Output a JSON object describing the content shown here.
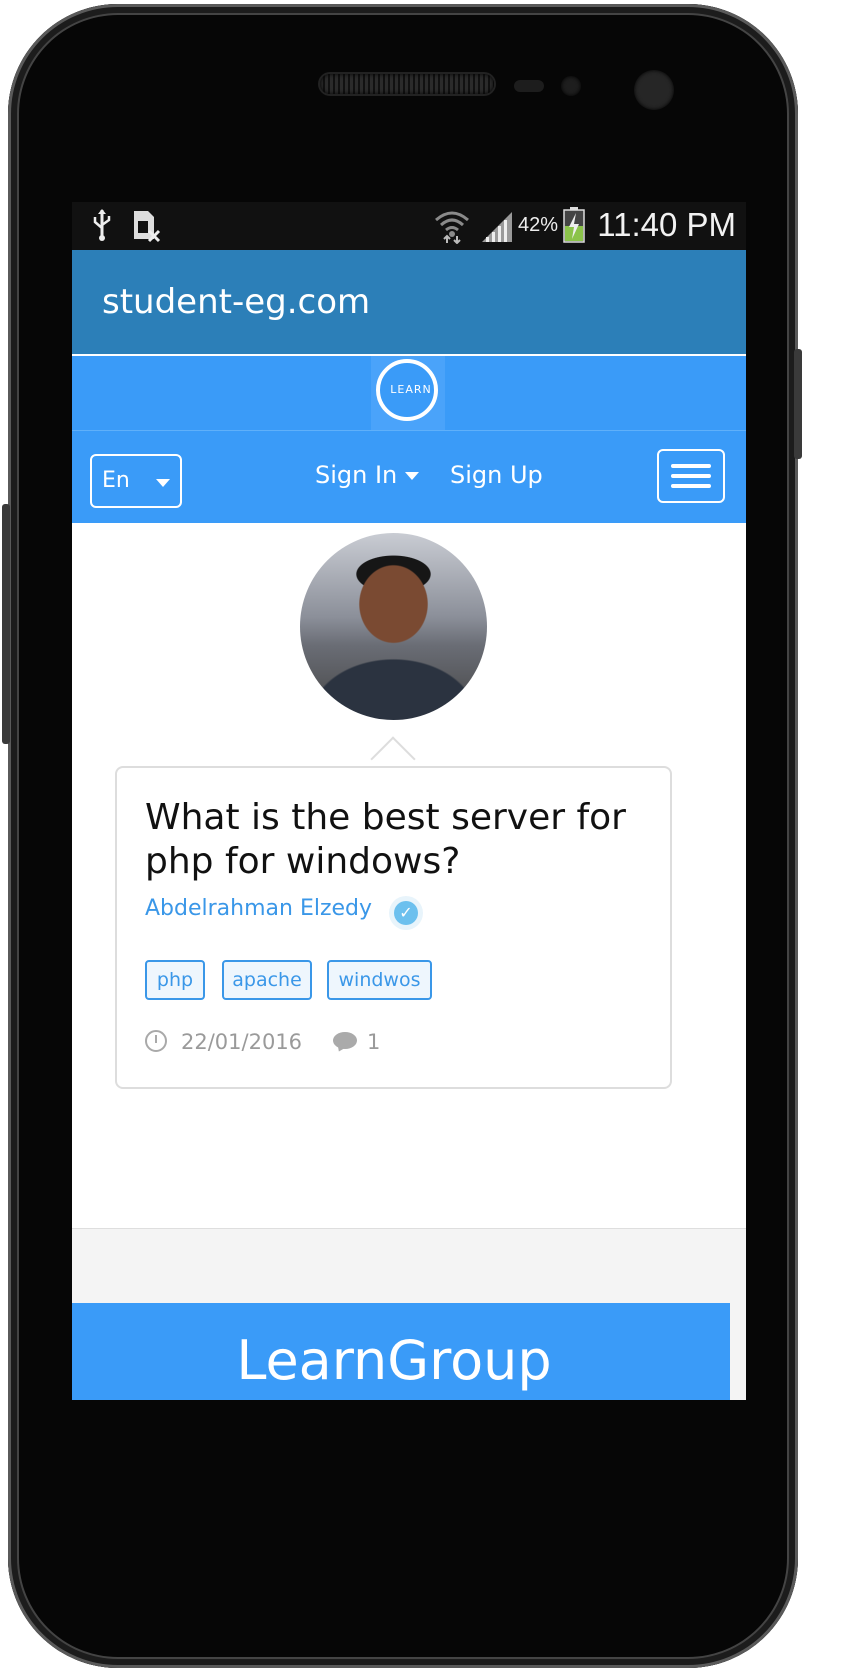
{
  "status_bar": {
    "battery_percent": "42%",
    "time": "11:40 PM",
    "icons": [
      "usb-icon",
      "no-sim-icon",
      "wifi-icon",
      "signal-icon",
      "battery-charging-icon"
    ]
  },
  "app_bar": {
    "title": "student-eg.com"
  },
  "logo": {
    "text": "LEARN"
  },
  "navbar": {
    "language": "En",
    "sign_in_label": "Sign In",
    "sign_up_label": "Sign Up"
  },
  "question_card": {
    "title": "What is the best server for php for windows?",
    "author": "Abdelrahman Elzedy",
    "tags": [
      "php",
      "apache",
      "windwos"
    ],
    "date": "22/01/2016",
    "comment_count": "1"
  },
  "footer": {
    "brand": "LearnGroup"
  },
  "colors": {
    "app_bar": "#2c7fb8",
    "nav_blue": "#3a9bf8",
    "link_blue": "#3a97e8"
  }
}
